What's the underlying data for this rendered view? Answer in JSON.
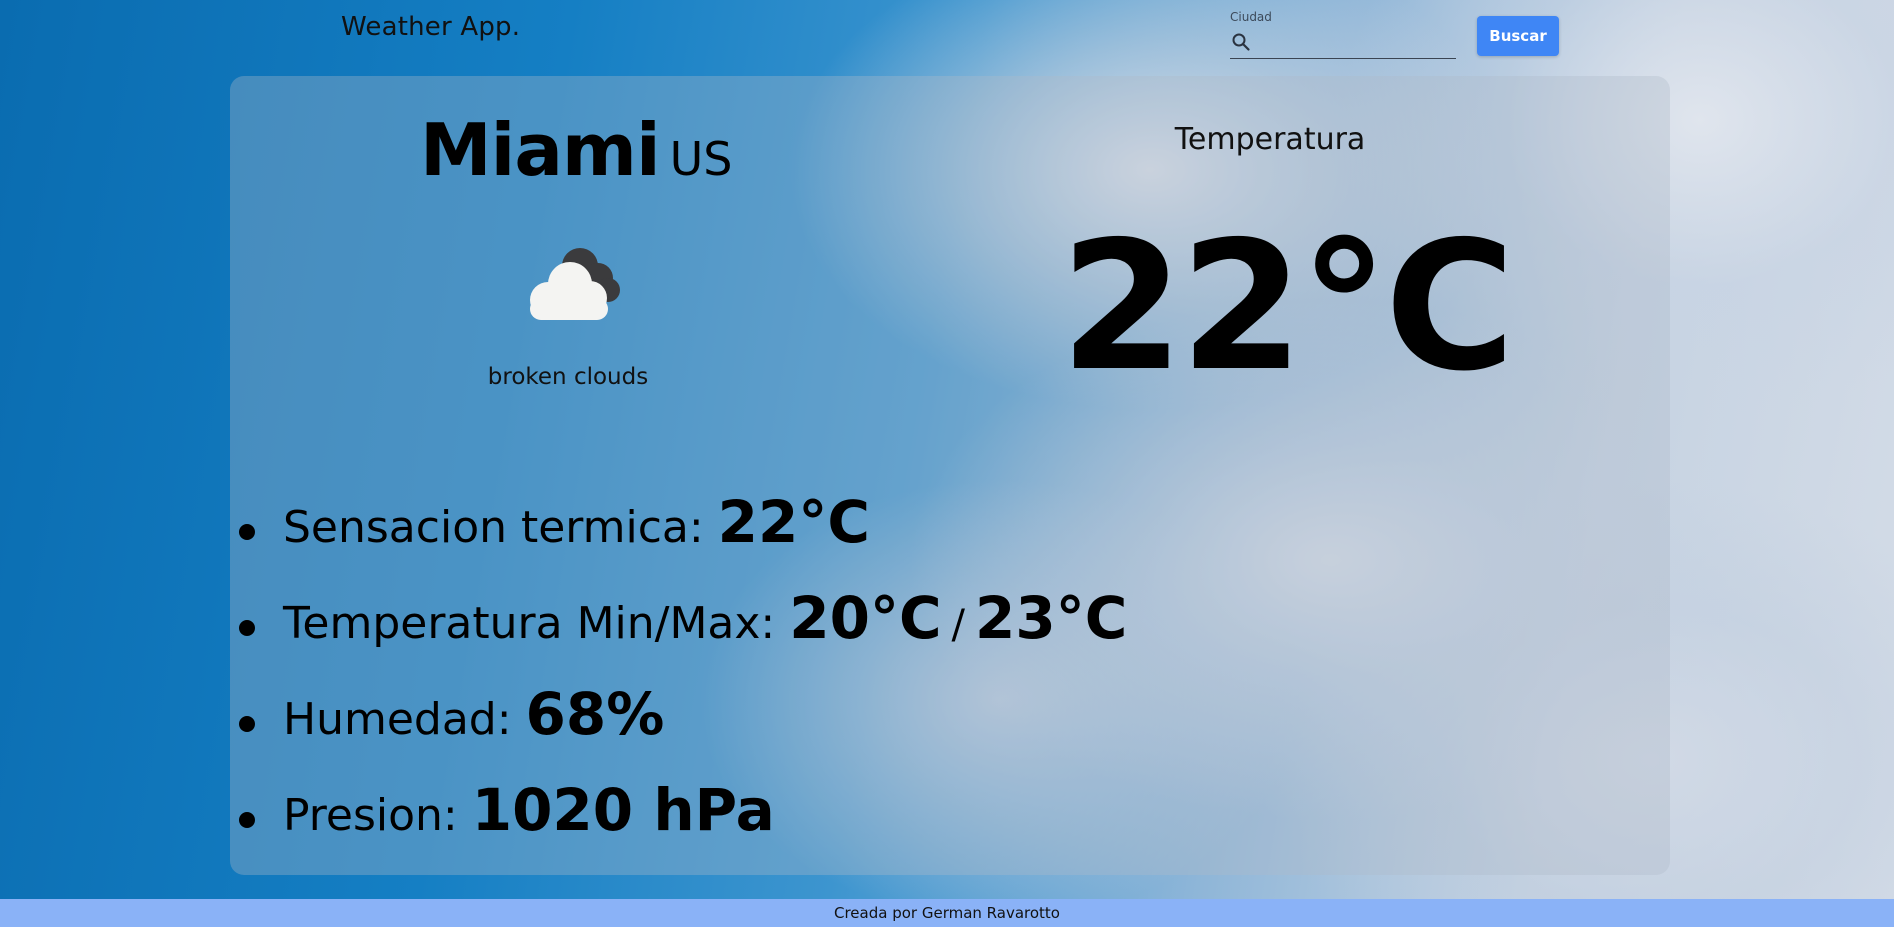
{
  "header": {
    "app_title": "Weather App.",
    "search": {
      "label": "Ciudad",
      "value": "",
      "icon": "search-icon"
    },
    "search_button_label": "Buscar"
  },
  "weather": {
    "city": "Miami",
    "country": "US",
    "icon": "broken-clouds-icon",
    "description": "broken clouds",
    "temperature_label": "Temperatura",
    "temperature": "22°C"
  },
  "details": {
    "feels_like": {
      "label": "Sensacion termica: ",
      "value": "22°C"
    },
    "min_max": {
      "label": "Temperatura Min/Max: ",
      "min": "20°C",
      "separator": "/",
      "max": "23°C"
    },
    "humidity": {
      "label": "Humedad: ",
      "value": "68%"
    },
    "pressure": {
      "label": "Presion: ",
      "value": "1020 hPa"
    }
  },
  "footer": {
    "text": "Creada por German Ravarotto"
  },
  "colors": {
    "button_bg": "#3f86f5",
    "footer_bg": "#8ab2f7"
  }
}
